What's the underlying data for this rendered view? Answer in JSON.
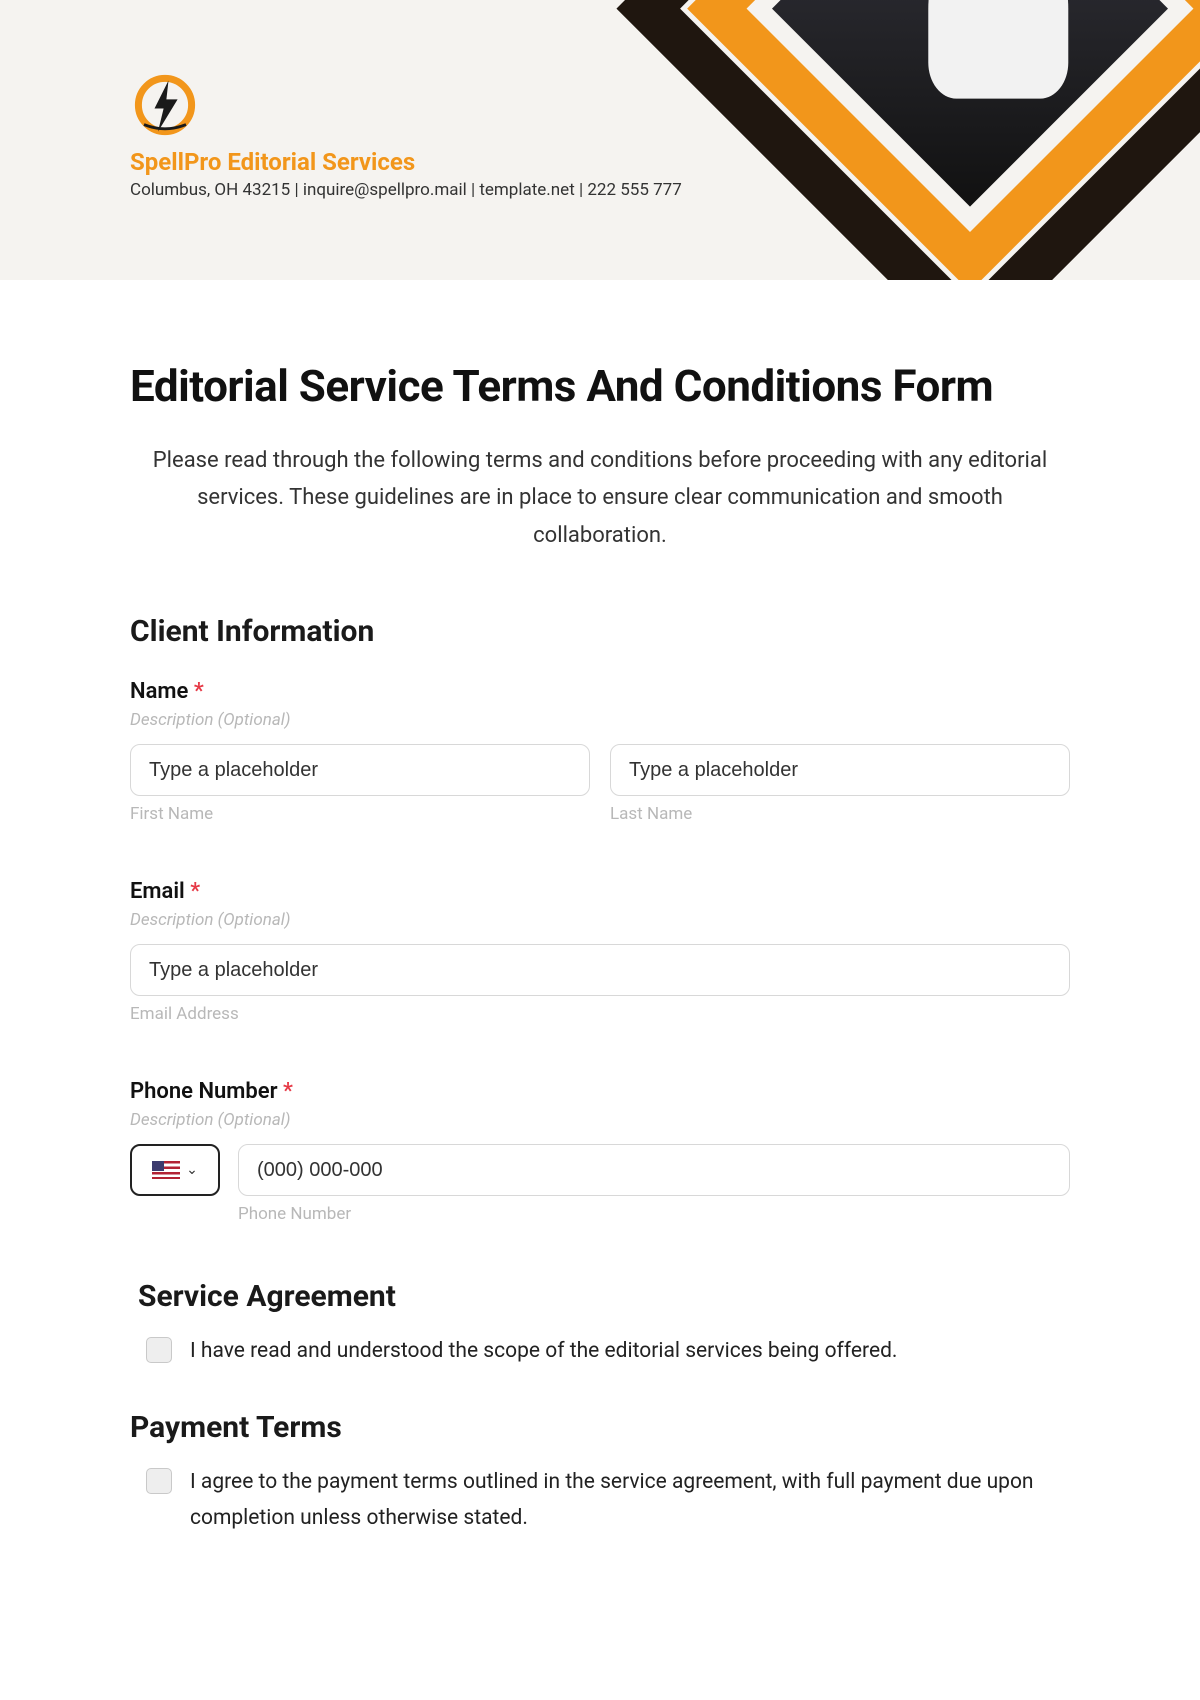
{
  "header": {
    "company_name": "SpellPro Editorial Services",
    "meta_line": "Columbus, OH 43215 | inquire@spellpro.mail | template.net | 222 555 777"
  },
  "page": {
    "title": "Editorial Service Terms And Conditions Form",
    "intro": "Please read through the following terms and conditions before proceeding with any editorial services. These guidelines are in place to ensure clear communication and smooth collaboration."
  },
  "sections": {
    "client_info_title": "Client Information",
    "service_agreement_title": "Service Agreement",
    "payment_terms_title": "Payment Terms"
  },
  "fields": {
    "name": {
      "label": "Name",
      "required_mark": "*",
      "desc": "Description (Optional)",
      "first_placeholder": "Type a placeholder",
      "last_placeholder": "Type a placeholder",
      "first_sub": "First Name",
      "last_sub": "Last Name"
    },
    "email": {
      "label": "Email",
      "required_mark": "*",
      "desc": "Description (Optional)",
      "placeholder": "Type a placeholder",
      "sub": "Email Address"
    },
    "phone": {
      "label": "Phone Number",
      "required_mark": "*",
      "desc": "Description (Optional)",
      "placeholder": "(000) 000-000",
      "sub": "Phone Number"
    }
  },
  "agreements": {
    "service": "I have read and understood the scope of the editorial services being offered.",
    "payment": "I agree to the payment terms outlined in the service agreement, with full payment due upon completion unless otherwise stated."
  }
}
